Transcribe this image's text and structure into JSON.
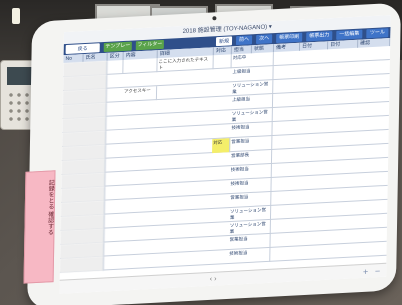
{
  "app": {
    "title": "2018 施設管理 (TOY-NAGANO)",
    "title_chevron": "▾"
  },
  "toolbar": {
    "buttons": [
      {
        "label": "戻る"
      },
      {
        "label": "テンプレート"
      },
      {
        "label": "フィルター"
      },
      {
        "label": "新規"
      },
      {
        "label": "前へ"
      },
      {
        "label": "次へ"
      },
      {
        "label": "帳票印刷"
      },
      {
        "label": "帳票出力"
      },
      {
        "label": "一括編集"
      },
      {
        "label": "ツール"
      }
    ]
  },
  "table": {
    "headers": [
      "No",
      "氏名",
      "区分",
      "内容",
      "詳細",
      "対応",
      "担当",
      "状態",
      "備考",
      "日付",
      "日付",
      "確認"
    ],
    "rows": [
      {
        "c1": "",
        "c2": "",
        "c3": "",
        "c4": "",
        "c5": "ここに入力されたテキスト",
        "c6": "",
        "c7": "対応中",
        "c8": "",
        "c9": ""
      },
      {
        "c1": "",
        "c2": "",
        "c3": "",
        "c4": "",
        "c5": "",
        "c6": "",
        "c7": "上級担当",
        "c8": "",
        "c9": ""
      },
      {
        "c1": "",
        "c2": "",
        "c3": "",
        "c4": "アクセスキー",
        "c5": "",
        "c6": "",
        "c7": "ソリューション営業",
        "c8": "",
        "c9": ""
      },
      {
        "c1": "",
        "c2": "",
        "c3": "",
        "c4": "",
        "c5": "",
        "c6": "",
        "c7": "上級担当",
        "c8": "",
        "c9": ""
      },
      {
        "c1": "",
        "c2": "",
        "c3": "",
        "c4": "",
        "c5": "",
        "c6": "",
        "c7": "ソリューション営業",
        "c8": "",
        "c9": ""
      },
      {
        "c1": "",
        "c2": "",
        "c3": "",
        "c4": "",
        "c5": "",
        "c6": "",
        "c7": "技術担当",
        "c8": "",
        "c9": ""
      },
      {
        "c1": "",
        "c2": "",
        "c3": "",
        "c4": "",
        "c5": "",
        "c6": "対応",
        "c7": "営業担当",
        "c8": "",
        "c9": ""
      },
      {
        "c1": "",
        "c2": "",
        "c3": "",
        "c4": "",
        "c5": "",
        "c6": "",
        "c7": "営業部長",
        "c8": "",
        "c9": ""
      },
      {
        "c1": "",
        "c2": "",
        "c3": "",
        "c4": "",
        "c5": "",
        "c6": "",
        "c7": "技術担当",
        "c8": "",
        "c9": ""
      },
      {
        "c1": "",
        "c2": "",
        "c3": "",
        "c4": "",
        "c5": "",
        "c6": "",
        "c7": "技術担当",
        "c8": "",
        "c9": ""
      },
      {
        "c1": "",
        "c2": "",
        "c3": "",
        "c4": "",
        "c5": "",
        "c6": "",
        "c7": "営業担当",
        "c8": "",
        "c9": ""
      },
      {
        "c1": "",
        "c2": "",
        "c3": "",
        "c4": "",
        "c5": "",
        "c6": "",
        "c7": "ソリューション営業",
        "c8": "",
        "c9": ""
      },
      {
        "c1": "",
        "c2": "",
        "c3": "",
        "c4": "",
        "c5": "",
        "c6": "",
        "c7": "ソリューション営業",
        "c8": "",
        "c9": ""
      },
      {
        "c1": "",
        "c2": "",
        "c3": "",
        "c4": "",
        "c5": "",
        "c6": "",
        "c7": "営業担当",
        "c8": "",
        "c9": ""
      },
      {
        "c1": "",
        "c2": "",
        "c3": "",
        "c4": "",
        "c5": "",
        "c6": "",
        "c7": "技術担当",
        "c8": "",
        "c9": ""
      }
    ]
  },
  "bottom": {
    "pager": "‹ ›",
    "add_symbol": "+",
    "remove_symbol": "−"
  },
  "sticky_note": {
    "text": "記録をとる 確認する"
  },
  "colors": {
    "accent": "#2f4f8a",
    "highlight": "#f4ee6a",
    "sticky": "#f7b8c4"
  }
}
